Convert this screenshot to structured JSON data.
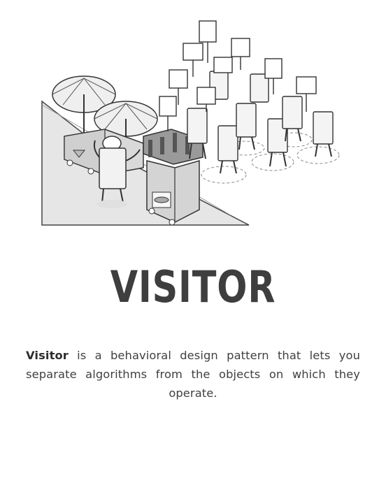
{
  "title": "VISITOR",
  "intro": {
    "term": "Visitor",
    "rest": " is a behavioral design pattern that lets you separate algorithms from the objects on which they operate."
  }
}
